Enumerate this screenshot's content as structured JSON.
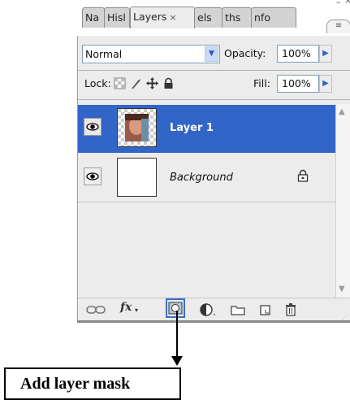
{
  "window": {
    "minimize_glyph": "–",
    "close_glyph": "×",
    "panel_menu_glyph": "≡"
  },
  "tabs": [
    {
      "label": "Na",
      "active": false
    },
    {
      "label": "Hisl",
      "active": false
    },
    {
      "label": "Layers",
      "active": true
    },
    {
      "label": "els",
      "active": false
    },
    {
      "label": "ths",
      "active": false
    },
    {
      "label": "nfo",
      "active": false
    }
  ],
  "tab_close_glyph": "×",
  "blend": {
    "mode": "Normal",
    "opacity_label": "Opacity:",
    "opacity_value": "100%"
  },
  "lock": {
    "label": "Lock:",
    "fill_label": "Fill:",
    "fill_value": "100%"
  },
  "layers": [
    {
      "name": "Layer 1",
      "selected": true,
      "visible": true,
      "locked": false
    },
    {
      "name": "Background",
      "selected": false,
      "visible": true,
      "locked": true
    }
  ],
  "toolbar": {
    "fx_label": "fx"
  },
  "callout": {
    "text": "Add layer mask"
  },
  "colors": {
    "selection": "#3166c8",
    "panel": "#ececec",
    "callout_border": "#000000"
  }
}
